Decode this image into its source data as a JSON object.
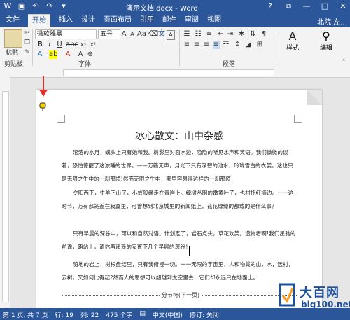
{
  "window": {
    "title": "演示文档.docx - Word",
    "quick_access": [
      "save-icon",
      "undo-icon",
      "redo-icon",
      "customize-icon"
    ],
    "buttons": [
      "?",
      "⧉",
      "—",
      "□",
      "✕"
    ]
  },
  "tabs": [
    {
      "label": "文件",
      "active": false
    },
    {
      "label": "开始",
      "active": true
    },
    {
      "label": "插入",
      "active": false
    },
    {
      "label": "设计",
      "active": false
    },
    {
      "label": "页面布局",
      "active": false
    },
    {
      "label": "引用",
      "active": false
    },
    {
      "label": "邮件",
      "active": false
    },
    {
      "label": "审阅",
      "active": false
    },
    {
      "label": "视图",
      "active": false
    }
  ],
  "user": "北院 左...",
  "ribbon": {
    "paste_label": "粘贴",
    "clipboard_group": "剪贴板",
    "font_name": "微软雅黑",
    "font_size": "五号",
    "font_group": "字体",
    "paragraph_group": "段落",
    "styles_label": "样式",
    "editing_label": "编辑",
    "styles_icon": "A"
  },
  "document": {
    "title": "冰心散文：山中杂感",
    "paragraphs": [
      "溶溶的水月，螭头上只有她和我。树影里对面水边，隐隐的听见水声和笑语。我们微微的谈着，恐怕惊醒了这浓睡的世界。——万籁无声，月光下只有深碧的池水，玲珑雪白的衣裳。这也只是无限之生中的一刹那顷!然而无限之生中，哪里容易得这样的一刹那顷！",
      "夕阳西下，牛羊下山了，小蚁般缘走在青岩上。绿树丛阴的嫩黄叶子，也衬托红墙边。一一这时节，万有都笼盖在寂寞里，可曾想到北京城里的新闻纸上，花花绿绿的都载的是什么事？",
      "只有早晨的深谷中，可以和自然对语。计划定了，岩石点头，草花欢笑。造物者啊!我们星驰的前途，路站上，请你再遥遥的安置下几个早晨的深谷！",
      "随地的岩上，树根盘结里，只有我俯视一切。一一无限的宇宙里，人和物質的山，水，远村，云树，又如何比得起?然而人的思想可以超越到太空里去，它们却永远只在地面上。"
    ],
    "section_break": "分节符(下一页)"
  },
  "status": {
    "page": "第 1 页, 共 7 页",
    "lines": "行: 19",
    "column": "列: 22",
    "words": "475 个字",
    "language": "中文(中国)",
    "revision": "修订: 关闭"
  },
  "watermark": {
    "name": "大百网",
    "url": "big100.net"
  },
  "colors": {
    "accent": "#2b579a",
    "ribbon_bg": "#f3f3f3",
    "pointer": "#e0322c",
    "logo": "#1e4f9b"
  }
}
